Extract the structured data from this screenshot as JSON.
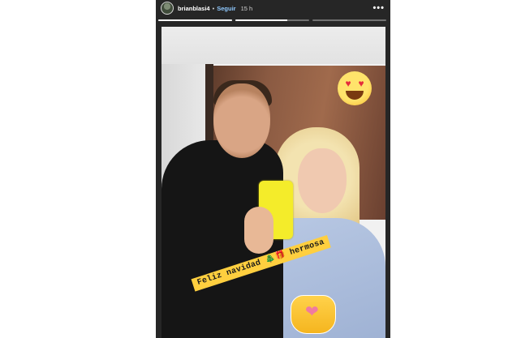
{
  "story": {
    "username": "brianblasi4",
    "separator": "•",
    "follow_label": "Seguir",
    "time": "15 h",
    "more_label": "•••",
    "progress": [
      1,
      0.7,
      0
    ]
  },
  "stickers": {
    "caption": "Feliz navidad 🎄🎁 hermosa",
    "emoji": "😍",
    "hands": "❤"
  },
  "colors": {
    "story_bg": "#262626",
    "follow": "#8fc9ff",
    "caption_bg": "#ffcf3f"
  }
}
